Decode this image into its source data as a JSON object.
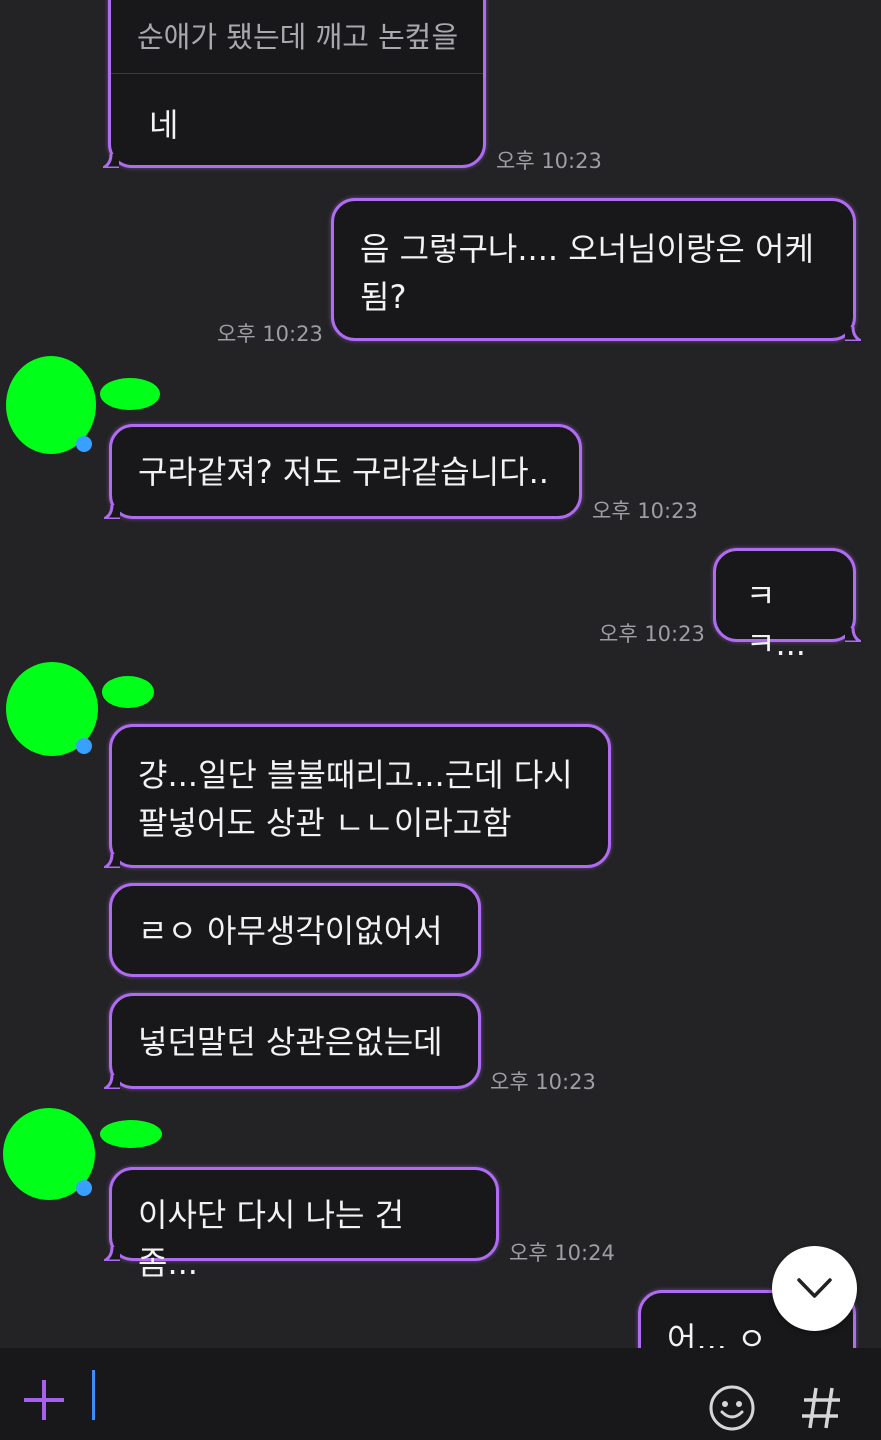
{
  "messages": [
    {
      "id": "q",
      "quote": "순애가 됐는데 깨고 논컾을",
      "text": "네",
      "time": "오후 10:23"
    },
    {
      "id": "m1",
      "lines": [
        "음 그렇구나.... 오너님이랑은 어케",
        "됨?"
      ],
      "time": "오후 10:23"
    },
    {
      "id": "m2",
      "text": "구라같져? 저도 구라같습니다..",
      "time": "오후 10:23"
    },
    {
      "id": "m3",
      "text": "ㅋㅋ...",
      "time": "오후 10:23"
    },
    {
      "id": "m4",
      "lines": [
        "걍...일단 블불때리고...근데 다시",
        "팔넣어도 상관 ㄴㄴ이라고함"
      ]
    },
    {
      "id": "m5",
      "text": "ㄹㅇ 아무생각이없어서"
    },
    {
      "id": "m6",
      "text": "넣던말던 상관은없는데",
      "time": "오후 10:23"
    },
    {
      "id": "m7",
      "text": "이사단 다시 나는 건 좀...",
      "time": "오후 10:24"
    },
    {
      "id": "m8",
      "text": "어... ㅇㅇ...."
    }
  ],
  "icons": {
    "plus": "plus-icon",
    "emoji": "emoji-icon",
    "hashtag": "hashtag-icon",
    "scroll_down": "chevron-down-icon"
  },
  "colors": {
    "accent": "#b06cf0",
    "background": "#232325",
    "bubble": "#18181b",
    "input_bar": "#18181a",
    "redaction": "#00ff19",
    "cursor": "#3a8cff"
  }
}
